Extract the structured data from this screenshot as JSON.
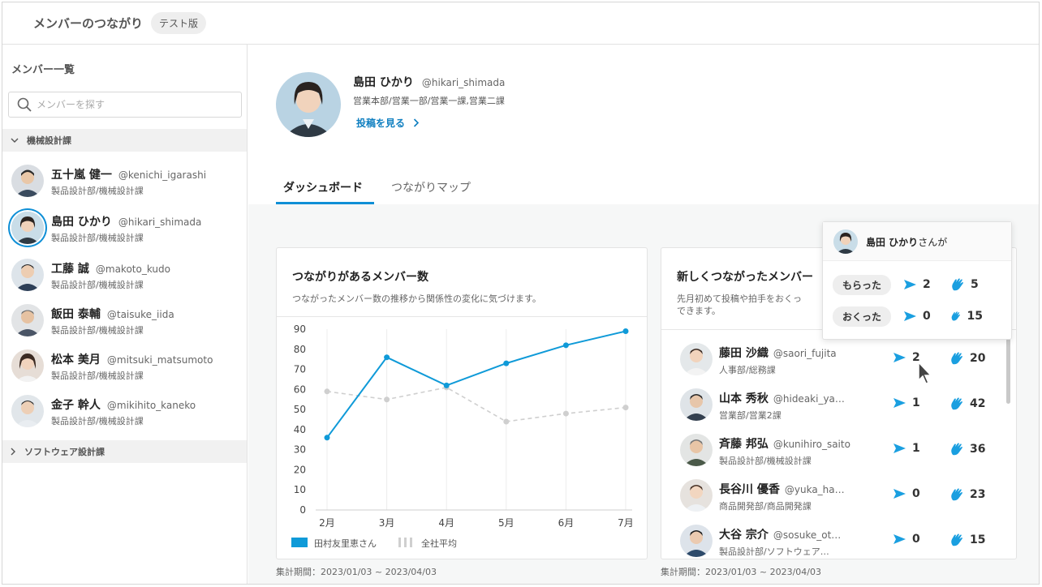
{
  "app": {
    "title": "メンバーのつながり",
    "badge": "テスト版"
  },
  "sidebar": {
    "title": "メンバー一覧",
    "search_placeholder": "メンバーを探す",
    "groups": [
      {
        "label": "機械設計課",
        "expanded": true
      },
      {
        "label": "ソフトウェア設計課",
        "expanded": false
      }
    ],
    "members": [
      {
        "name": "五十嵐 健一",
        "handle": "@kenichi_igarashi",
        "dept": "製品設計部/機械設計課"
      },
      {
        "name": "島田 ひかり",
        "handle": "@hikari_shimada",
        "dept": "製品設計部/機械設計課",
        "selected": true
      },
      {
        "name": "工藤 誠",
        "handle": "@makoto_kudo",
        "dept": "製品設計部/機械設計課"
      },
      {
        "name": "飯田 泰輔",
        "handle": "@taisuke_iida",
        "dept": "製品設計部/機械設計課"
      },
      {
        "name": "松本 美月",
        "handle": "@mitsuki_matsumoto",
        "dept": "製品設計部/機械設計課"
      },
      {
        "name": "金子 幹人",
        "handle": "@mikihito_kaneko",
        "dept": "製品設計部/機械設計課"
      }
    ]
  },
  "profile": {
    "name": "島田 ひかり",
    "handle": "@hikari_shimada",
    "dept": "営業本部/営業一部/営業一課,営業二課",
    "link": "投稿を見る"
  },
  "tabs": [
    {
      "label": "ダッシュボード",
      "active": true
    },
    {
      "label": "つながりマップ",
      "active": false
    }
  ],
  "chart_card": {
    "title": "つながりがあるメンバー数",
    "subtitle": "つながったメンバー数の推移から関係性の変化に気づけます。",
    "period": "集計期間：2023/01/03 ~ 2023/04/03"
  },
  "chart_data": {
    "type": "line",
    "x": [
      "2月",
      "3月",
      "4月",
      "5月",
      "6月",
      "7月"
    ],
    "ylim": [
      0,
      90
    ],
    "yticks": [
      0,
      10,
      20,
      30,
      40,
      50,
      60,
      70,
      80,
      90
    ],
    "grid": true,
    "legend_position": "bottom-left",
    "series": [
      {
        "name": "田村友里恵さん",
        "values": [
          36,
          76,
          62,
          73,
          82,
          89
        ],
        "color": "#0f9ad8",
        "style": "solid"
      },
      {
        "name": "全社平均",
        "values": [
          59,
          55,
          61,
          44,
          48,
          51
        ],
        "color": "#cfcfcf",
        "style": "dashed"
      }
    ]
  },
  "new_card": {
    "title": "新しくつながったメンバー",
    "subtitle_line1": "先月初めて投稿や拍手をおくっ",
    "subtitle_line2": "できます。",
    "period": "集計期間：2023/01/03 ~ 2023/04/03",
    "rows": [
      {
        "name": "藤田 沙織",
        "handle": "@saori_fujita",
        "dept": "人事部/総務課",
        "sent": "2",
        "claps": "20"
      },
      {
        "name": "山本 秀秋",
        "handle": "@hideaki_ya…",
        "dept": "営業部/営業2課",
        "sent": "1",
        "claps": "42"
      },
      {
        "name": "斉藤 邦弘",
        "handle": "@kunihiro_saito",
        "dept": "製品設計部/機械設計課",
        "sent": "1",
        "claps": "36"
      },
      {
        "name": "長谷川 優香",
        "handle": "@yuka_ha…",
        "dept": "商品開発部/商品開発課",
        "sent": "0",
        "claps": "23"
      },
      {
        "name": "大谷 宗介",
        "handle": "@sosuke_ot…",
        "dept": "製品設計部/ソフトウェア…",
        "sent": "0",
        "claps": "15"
      }
    ]
  },
  "popover": {
    "name": "島田 ひかり",
    "suffix": "さんが",
    "received_label": "もらった",
    "received_sent": "2",
    "received_claps": "5",
    "sent_label": "おくった",
    "sent_sent": "0",
    "sent_claps": "15"
  },
  "colors": {
    "accent": "#0f8fd6",
    "icon": "#1a9fe0",
    "avg": "#cfcfcf"
  },
  "icons": {
    "send": "send-icon",
    "clap": "clap-icon",
    "search": "search-icon"
  }
}
